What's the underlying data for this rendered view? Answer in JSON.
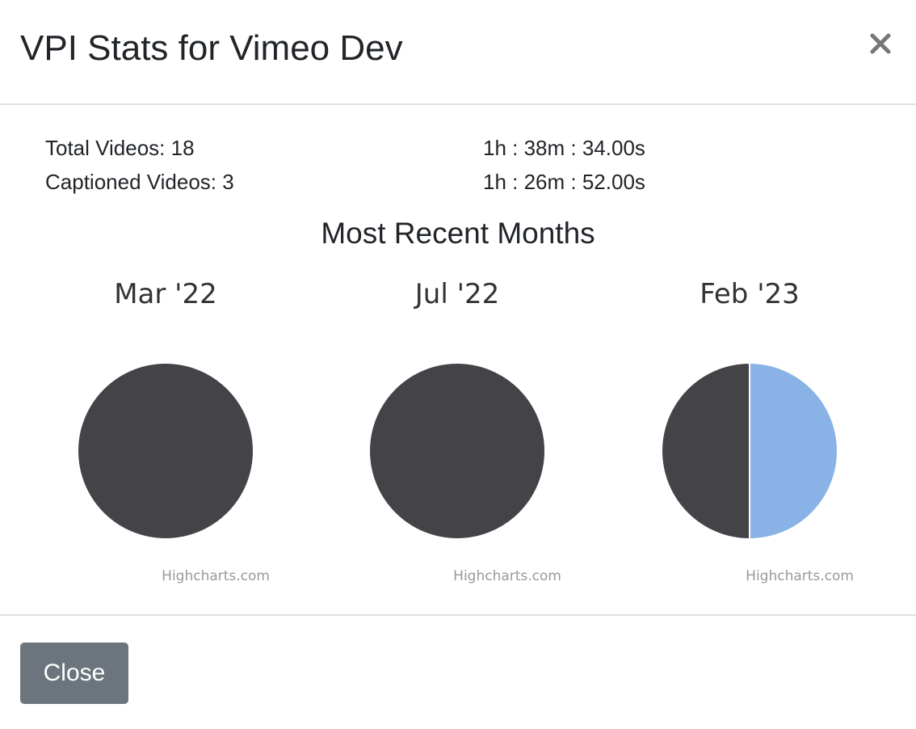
{
  "modal": {
    "title": "VPI Stats for Vimeo Dev",
    "close_icon": "close-x-icon"
  },
  "stats": {
    "total_videos_label": "Total Videos: 18",
    "total_duration": "1h : 38m : 34.00s",
    "captioned_videos_label": "Captioned Videos: 3",
    "captioned_duration": "1h : 26m : 52.00s"
  },
  "section": {
    "title": "Most Recent Months"
  },
  "colors": {
    "dark_slice": "#434348",
    "light_slice": "#89b3e6",
    "credit": "#999999"
  },
  "chart_data": [
    {
      "type": "pie",
      "title": "Mar '22",
      "credit": "Highcharts.com",
      "values": [
        100
      ],
      "colors": [
        "#434348"
      ]
    },
    {
      "type": "pie",
      "title": "Jul '22",
      "credit": "Highcharts.com",
      "values": [
        100
      ],
      "colors": [
        "#434348"
      ]
    },
    {
      "type": "pie",
      "title": "Feb '23",
      "credit": "Highcharts.com",
      "values": [
        50,
        50
      ],
      "colors": [
        "#89b3e6",
        "#434348"
      ]
    }
  ],
  "footer": {
    "close_label": "Close"
  }
}
